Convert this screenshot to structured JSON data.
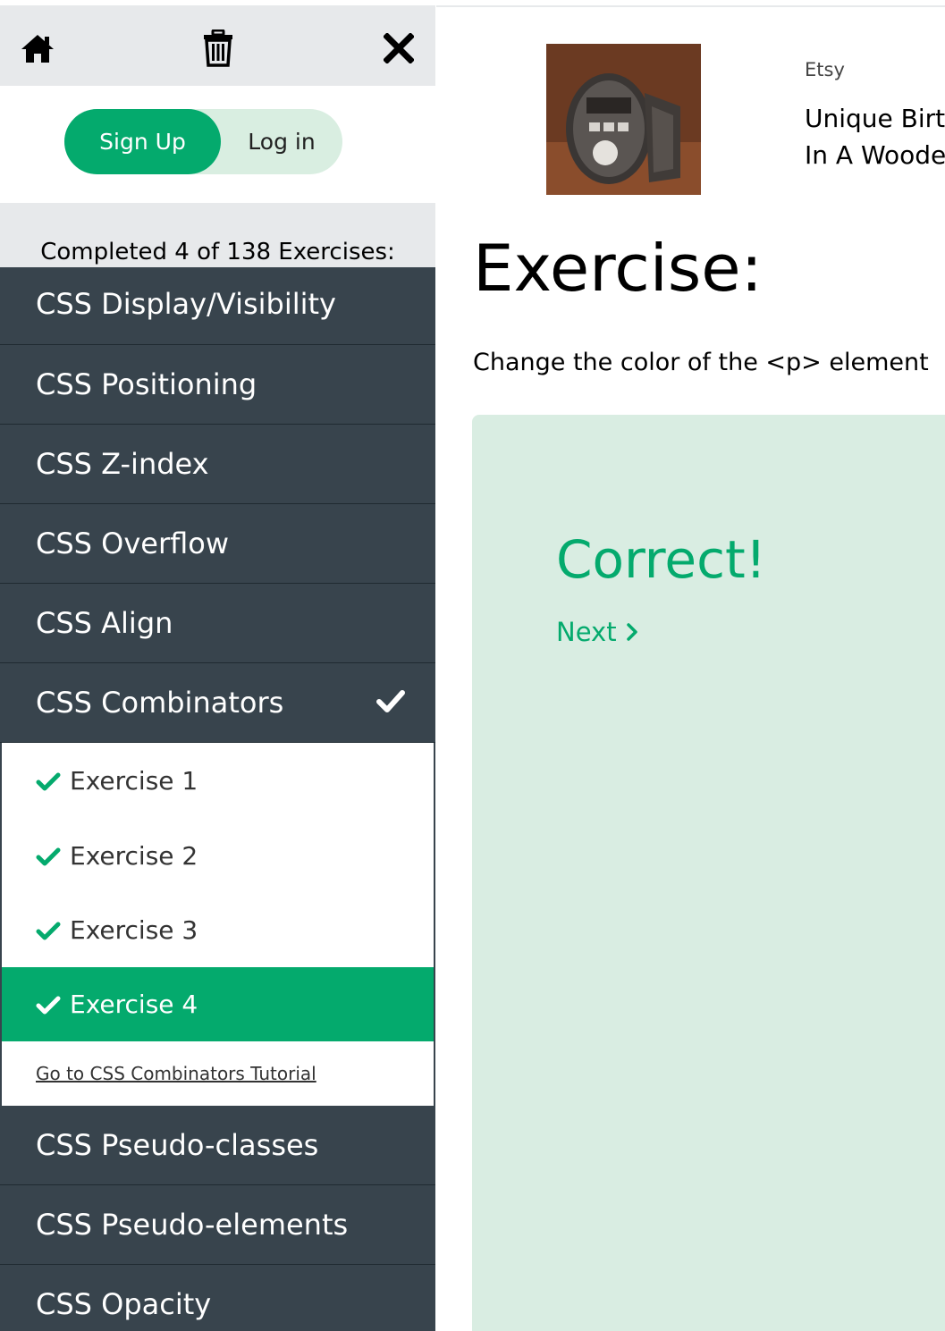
{
  "topbar": {
    "icons": [
      "home-icon",
      "trash-icon",
      "close-icon"
    ]
  },
  "auth": {
    "signup_label": "Sign Up",
    "login_label": "Log in"
  },
  "progress": {
    "text": "Completed 4 of 138 Exercises:",
    "completed": 4,
    "total": 138
  },
  "categories_before": [
    {
      "label": "CSS Display/Visibility"
    },
    {
      "label": "CSS Positioning"
    },
    {
      "label": "CSS Z-index"
    },
    {
      "label": "CSS Overflow"
    },
    {
      "label": "CSS Align"
    }
  ],
  "current_category": {
    "label": "CSS Combinators",
    "completed": true,
    "exercises": [
      {
        "label": "Exercise 1",
        "done": true
      },
      {
        "label": "Exercise 2",
        "done": true
      },
      {
        "label": "Exercise 3",
        "done": true
      },
      {
        "label": "Exercise 4",
        "done": true,
        "active": true
      }
    ],
    "tutorial_link": "Go to CSS Combinators Tutorial"
  },
  "categories_after": [
    {
      "label": "CSS Pseudo-classes"
    },
    {
      "label": "CSS Pseudo-elements"
    },
    {
      "label": "CSS Opacity"
    }
  ],
  "ad": {
    "source": "Etsy",
    "title_line1": "Unique Birth",
    "title_line2": "In A Woode"
  },
  "main": {
    "title": "Exercise:",
    "instruction": "Change the color of the <p> element",
    "result": "Correct!",
    "next_label": "Next"
  },
  "colors": {
    "accent": "#04aa6d",
    "sidebar_dark": "#38444d",
    "light_gray": "#e7e9eb",
    "result_bg": "#d9ede2"
  }
}
